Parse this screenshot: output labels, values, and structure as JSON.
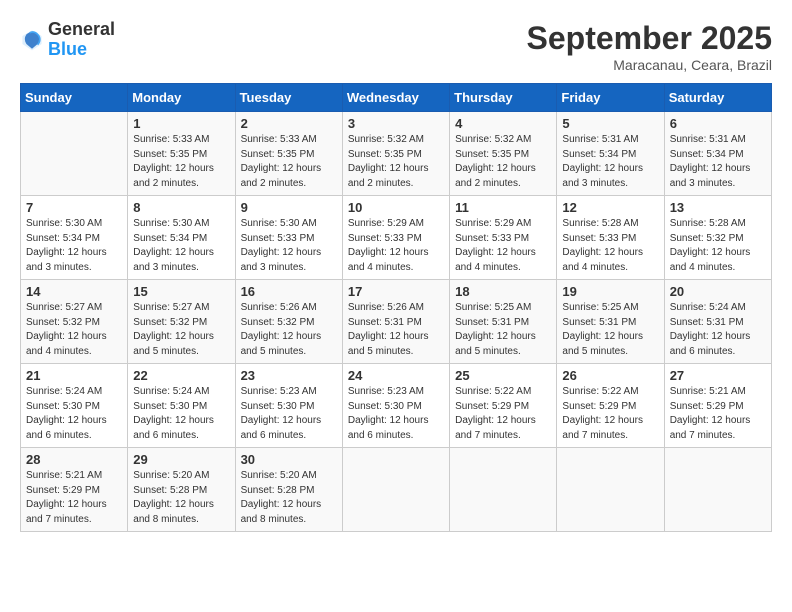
{
  "header": {
    "logo_general": "General",
    "logo_blue": "Blue",
    "month": "September 2025",
    "location": "Maracanau, Ceara, Brazil"
  },
  "weekdays": [
    "Sunday",
    "Monday",
    "Tuesday",
    "Wednesday",
    "Thursday",
    "Friday",
    "Saturday"
  ],
  "weeks": [
    [
      {
        "day": "",
        "info": ""
      },
      {
        "day": "1",
        "info": "Sunrise: 5:33 AM\nSunset: 5:35 PM\nDaylight: 12 hours\nand 2 minutes."
      },
      {
        "day": "2",
        "info": "Sunrise: 5:33 AM\nSunset: 5:35 PM\nDaylight: 12 hours\nand 2 minutes."
      },
      {
        "day": "3",
        "info": "Sunrise: 5:32 AM\nSunset: 5:35 PM\nDaylight: 12 hours\nand 2 minutes."
      },
      {
        "day": "4",
        "info": "Sunrise: 5:32 AM\nSunset: 5:35 PM\nDaylight: 12 hours\nand 2 minutes."
      },
      {
        "day": "5",
        "info": "Sunrise: 5:31 AM\nSunset: 5:34 PM\nDaylight: 12 hours\nand 3 minutes."
      },
      {
        "day": "6",
        "info": "Sunrise: 5:31 AM\nSunset: 5:34 PM\nDaylight: 12 hours\nand 3 minutes."
      }
    ],
    [
      {
        "day": "7",
        "info": "Sunrise: 5:30 AM\nSunset: 5:34 PM\nDaylight: 12 hours\nand 3 minutes."
      },
      {
        "day": "8",
        "info": "Sunrise: 5:30 AM\nSunset: 5:34 PM\nDaylight: 12 hours\nand 3 minutes."
      },
      {
        "day": "9",
        "info": "Sunrise: 5:30 AM\nSunset: 5:33 PM\nDaylight: 12 hours\nand 3 minutes."
      },
      {
        "day": "10",
        "info": "Sunrise: 5:29 AM\nSunset: 5:33 PM\nDaylight: 12 hours\nand 4 minutes."
      },
      {
        "day": "11",
        "info": "Sunrise: 5:29 AM\nSunset: 5:33 PM\nDaylight: 12 hours\nand 4 minutes."
      },
      {
        "day": "12",
        "info": "Sunrise: 5:28 AM\nSunset: 5:33 PM\nDaylight: 12 hours\nand 4 minutes."
      },
      {
        "day": "13",
        "info": "Sunrise: 5:28 AM\nSunset: 5:32 PM\nDaylight: 12 hours\nand 4 minutes."
      }
    ],
    [
      {
        "day": "14",
        "info": "Sunrise: 5:27 AM\nSunset: 5:32 PM\nDaylight: 12 hours\nand 4 minutes."
      },
      {
        "day": "15",
        "info": "Sunrise: 5:27 AM\nSunset: 5:32 PM\nDaylight: 12 hours\nand 5 minutes."
      },
      {
        "day": "16",
        "info": "Sunrise: 5:26 AM\nSunset: 5:32 PM\nDaylight: 12 hours\nand 5 minutes."
      },
      {
        "day": "17",
        "info": "Sunrise: 5:26 AM\nSunset: 5:31 PM\nDaylight: 12 hours\nand 5 minutes."
      },
      {
        "day": "18",
        "info": "Sunrise: 5:25 AM\nSunset: 5:31 PM\nDaylight: 12 hours\nand 5 minutes."
      },
      {
        "day": "19",
        "info": "Sunrise: 5:25 AM\nSunset: 5:31 PM\nDaylight: 12 hours\nand 5 minutes."
      },
      {
        "day": "20",
        "info": "Sunrise: 5:24 AM\nSunset: 5:31 PM\nDaylight: 12 hours\nand 6 minutes."
      }
    ],
    [
      {
        "day": "21",
        "info": "Sunrise: 5:24 AM\nSunset: 5:30 PM\nDaylight: 12 hours\nand 6 minutes."
      },
      {
        "day": "22",
        "info": "Sunrise: 5:24 AM\nSunset: 5:30 PM\nDaylight: 12 hours\nand 6 minutes."
      },
      {
        "day": "23",
        "info": "Sunrise: 5:23 AM\nSunset: 5:30 PM\nDaylight: 12 hours\nand 6 minutes."
      },
      {
        "day": "24",
        "info": "Sunrise: 5:23 AM\nSunset: 5:30 PM\nDaylight: 12 hours\nand 6 minutes."
      },
      {
        "day": "25",
        "info": "Sunrise: 5:22 AM\nSunset: 5:29 PM\nDaylight: 12 hours\nand 7 minutes."
      },
      {
        "day": "26",
        "info": "Sunrise: 5:22 AM\nSunset: 5:29 PM\nDaylight: 12 hours\nand 7 minutes."
      },
      {
        "day": "27",
        "info": "Sunrise: 5:21 AM\nSunset: 5:29 PM\nDaylight: 12 hours\nand 7 minutes."
      }
    ],
    [
      {
        "day": "28",
        "info": "Sunrise: 5:21 AM\nSunset: 5:29 PM\nDaylight: 12 hours\nand 7 minutes."
      },
      {
        "day": "29",
        "info": "Sunrise: 5:20 AM\nSunset: 5:28 PM\nDaylight: 12 hours\nand 8 minutes."
      },
      {
        "day": "30",
        "info": "Sunrise: 5:20 AM\nSunset: 5:28 PM\nDaylight: 12 hours\nand 8 minutes."
      },
      {
        "day": "",
        "info": ""
      },
      {
        "day": "",
        "info": ""
      },
      {
        "day": "",
        "info": ""
      },
      {
        "day": "",
        "info": ""
      }
    ]
  ]
}
